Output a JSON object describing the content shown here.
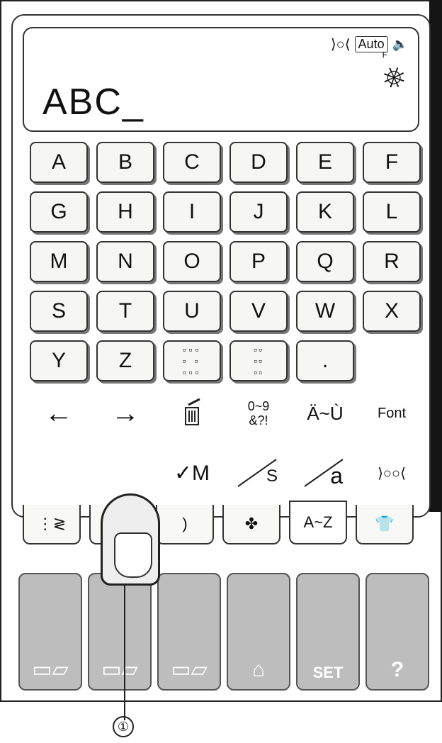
{
  "display": {
    "text": "ABC_",
    "status_auto": "Auto",
    "presser_foot_label": "F"
  },
  "keys": {
    "row1": [
      "A",
      "B",
      "C",
      "D",
      "E",
      "F"
    ],
    "row2": [
      "G",
      "H",
      "I",
      "J",
      "K",
      "L"
    ],
    "row3": [
      "M",
      "N",
      "O",
      "P",
      "Q",
      "R"
    ],
    "row4": [
      "S",
      "T",
      "U",
      "V",
      "W",
      "X"
    ],
    "row5": [
      "Y",
      "Z",
      "",
      "",
      "."
    ]
  },
  "function_row1": {
    "left_arrow": "←",
    "right_arrow": "→",
    "delete_icon": "delete-icon",
    "numbers_symbols": "0~9\n&?!",
    "accented": "Ä~Ù",
    "font": "Font"
  },
  "function_row2": {
    "memory_check": "✓M",
    "small_case": "S",
    "lower_case": "a"
  },
  "tabs": {
    "alphabet": "A~Z"
  },
  "callout": {
    "number": "①"
  },
  "icons": [
    "left-arrow-icon",
    "right-arrow-icon",
    "trash-icon",
    "folder-icon",
    "thread-tension-icon",
    "speaker-icon",
    "presser-foot-icon",
    "machine-icon",
    "embroidery-icon",
    "pc-icon",
    "save-icon",
    "set-icon",
    "help-icon"
  ],
  "colors": {
    "bottom_button": "#bdbdbd",
    "frame": "#222222",
    "black_band": "#141414"
  }
}
